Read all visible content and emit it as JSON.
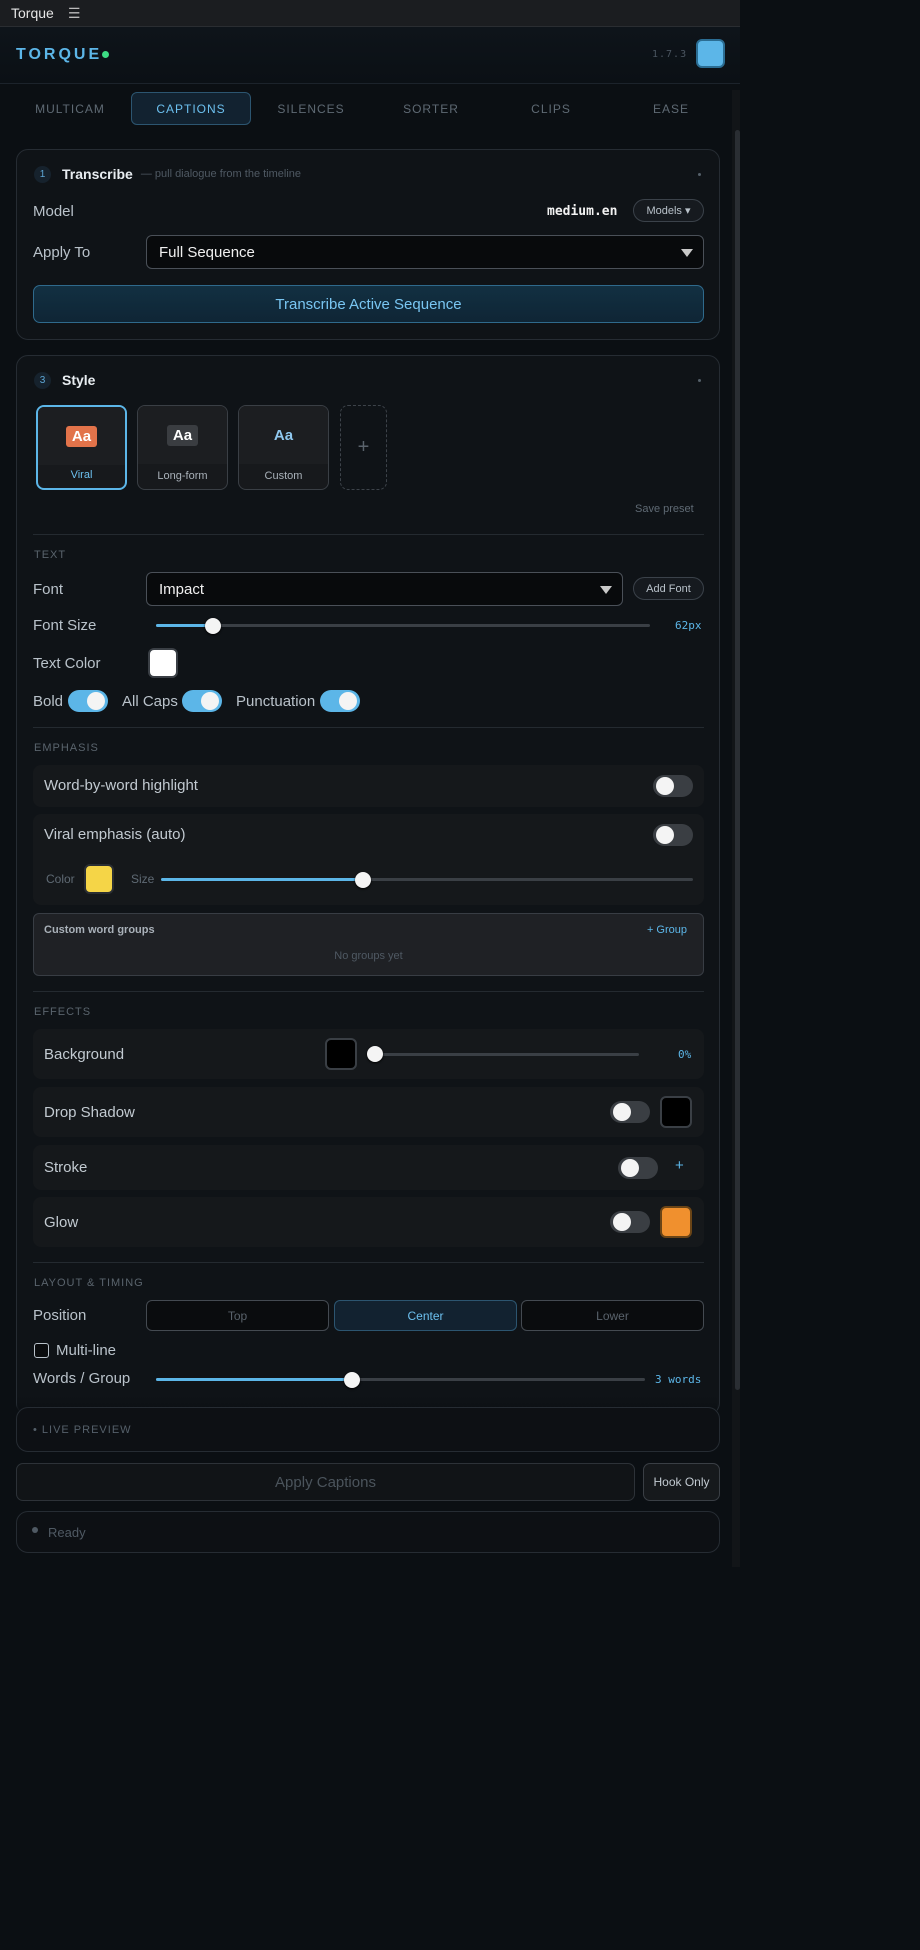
{
  "window": {
    "title": "Torque"
  },
  "header": {
    "brand": "TORQUE",
    "version": "1.7.3"
  },
  "tabs": [
    {
      "label": "MULTICAM"
    },
    {
      "label": "CAPTIONS",
      "active": true
    },
    {
      "label": "SILENCES"
    },
    {
      "label": "SORTER"
    },
    {
      "label": "CLIPS"
    },
    {
      "label": "EASE"
    }
  ],
  "transcribe": {
    "step": "1",
    "title": "Transcribe",
    "subtitle": "— pull dialogue from the timeline",
    "model_label": "Model",
    "model_value": "medium.en",
    "models_button": "Models ▾",
    "apply_label": "Apply To",
    "apply_value": "Full Sequence",
    "action_button": "Transcribe Active Sequence"
  },
  "style": {
    "step": "3",
    "title": "Style",
    "presets": [
      {
        "sample": "Aa",
        "name": "Viral",
        "active": true,
        "chip_bg": "#e2734a",
        "chip_fg": "#ffffff"
      },
      {
        "sample": "Aa",
        "name": "Long-form",
        "chip_bg": "#3a3d41",
        "chip_fg": "#ffffff"
      },
      {
        "sample": "Aa",
        "name": "Custom",
        "chip_bg": "transparent",
        "chip_fg": "#8fc8ef"
      }
    ],
    "add_preset": "+",
    "save_preset": "Save preset",
    "text": {
      "section": "TEXT",
      "font_label": "Font",
      "font_value": "Impact",
      "add_font": "Add Font",
      "size_label": "Font Size",
      "size_value": "62px",
      "size_fraction": 0.115,
      "color_label": "Text Color",
      "text_color": "#ffffff",
      "bold_label": "Bold",
      "bold_on": true,
      "caps_label": "All Caps",
      "caps_on": true,
      "punct_label": "Punctuation",
      "punct_on": true
    },
    "emphasis": {
      "section": "EMPHASIS",
      "word_highlight": "Word-by-word highlight",
      "word_highlight_on": false,
      "viral": "Viral emphasis (auto)",
      "viral_on": false,
      "color_label": "Color",
      "emphasis_color": "#f5d547",
      "size_label": "Size",
      "size_fraction": 0.38,
      "groups_title": "Custom word groups",
      "add_group": "+ Group",
      "groups_empty": "No groups yet"
    },
    "effects": {
      "section": "EFFECTS",
      "background": "Background",
      "background_color": "#000000",
      "background_value": "0%",
      "drop_shadow": "Drop Shadow",
      "drop_shadow_on": false,
      "shadow_color": "#000000",
      "stroke": "Stroke",
      "stroke_on": false,
      "stroke_add": "+",
      "glow": "Glow",
      "glow_on": false,
      "glow_color": "#f0902e"
    },
    "layout": {
      "section": "LAYOUT & TIMING",
      "position_label": "Position",
      "positions": [
        "Top",
        "Center",
        "Lower"
      ],
      "active_position": "Center",
      "multiline_label": "Multi-line",
      "multiline_checked": false,
      "words_label": "Words / Group",
      "words_value": "3 words",
      "words_fraction": 0.4
    }
  },
  "live_preview": "• LIVE PREVIEW",
  "apply_button": "Apply Captions",
  "hook_button": "Hook Only",
  "status": "Ready",
  "colors": {
    "accent": "#5cb6e8",
    "online": "#3ddc84"
  }
}
